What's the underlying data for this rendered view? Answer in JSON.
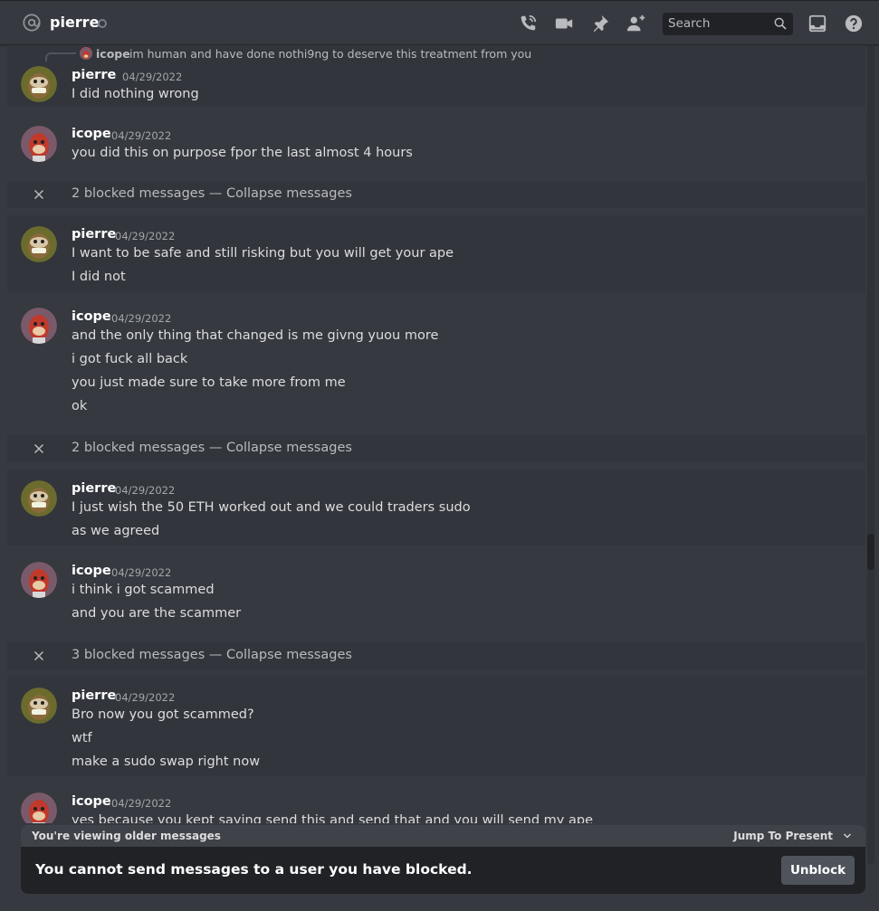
{
  "header": {
    "channel_name": "pierre",
    "search_placeholder": "Search",
    "icons": [
      "at-icon",
      "phone-call-icon",
      "video-call-icon",
      "pin-icon",
      "add-friend-icon",
      "search-icon",
      "inbox-icon",
      "help-icon"
    ]
  },
  "reply": {
    "author": "icope",
    "text": "im human and have done nothi9ng to deserve this treatment from you"
  },
  "messages": [
    {
      "author": "pierre",
      "timestamp": "04/29/2022",
      "lines": [
        "I did nothing wrong"
      ]
    },
    {
      "author": "icope",
      "timestamp": "04/29/2022",
      "lines": [
        "you did this on purpose fpor the last almost 4 hours"
      ]
    },
    {
      "author": "pierre",
      "timestamp": "04/29/2022",
      "lines": [
        "I want to be safe and still risking but you will get your ape",
        "I did not"
      ]
    },
    {
      "author": "icope",
      "timestamp": "04/29/2022",
      "lines": [
        "and the only thing that changed is me givng yuou more",
        "i got fuck all back",
        "you just made sure to take more from me",
        "ok"
      ]
    },
    {
      "author": "pierre",
      "timestamp": "04/29/2022",
      "lines": [
        "I just wish the 50 ETH worked out and we could traders sudo",
        "as we agreed"
      ]
    },
    {
      "author": "icope",
      "timestamp": "04/29/2022",
      "lines": [
        "i think i got scammed",
        "and you are the scammer"
      ]
    },
    {
      "author": "pierre",
      "timestamp": "04/29/2022",
      "lines": [
        "Bro now you got scammed?",
        "wtf",
        "make a sudo swap right now"
      ]
    },
    {
      "author": "icope",
      "timestamp": "04/29/2022",
      "lines": [
        "yes because you kept saying send this and send that and you will send my ape"
      ]
    }
  ],
  "blocked": [
    {
      "count_text": "2 blocked messages",
      "separator": " — ",
      "collapse_label": "Collapse messages"
    },
    {
      "count_text": "2 blocked messages",
      "separator": " — ",
      "collapse_label": "Collapse messages"
    },
    {
      "count_text": "3 blocked messages",
      "separator": " — ",
      "collapse_label": "Collapse messages"
    }
  ],
  "older_bar": {
    "text": "You're viewing older messages",
    "jump_label": "Jump To Present"
  },
  "composer": {
    "blocked_notice": "You cannot send messages to a user you have blocked.",
    "unblock_label": "Unblock"
  },
  "colors": {
    "background": "#36393f",
    "header_bg": "#36393f",
    "message_highlight": "#32353b",
    "composer_bg": "#202225",
    "button_bg": "#4f545c",
    "pierre_avatar": "#6b6b2e",
    "icope_avatar": "#7a5a6a"
  }
}
